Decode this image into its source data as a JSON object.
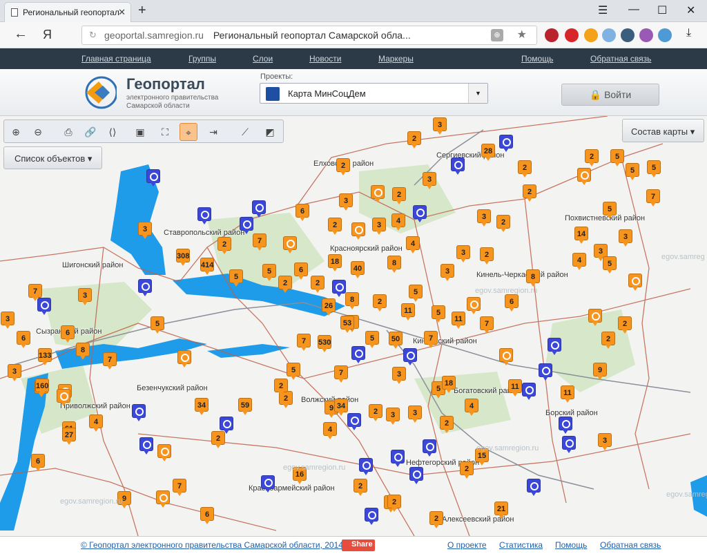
{
  "browser": {
    "tab_title": "Региональный геопортал",
    "url_domain": "geoportal.samregion.ru",
    "url_title": "Региональный геопортал Самарской обла..."
  },
  "nav": {
    "items": [
      "Главная страница",
      "Группы",
      "Слои",
      "Новости",
      "Маркеры",
      "Помощь",
      "Обратная связь"
    ]
  },
  "header": {
    "brand": "Геопортал",
    "brand_sub": "электронного правительства Самарской области",
    "projects_label": "Проекты:",
    "project_value": "Карта МинСоцДем",
    "login_label": "Войти"
  },
  "map_ui": {
    "objects_list": "Список объектов",
    "layers": "Состав карты"
  },
  "map_labels": [
    "Ставропольский район",
    "Шигонский район",
    "Сызранский район",
    "Безенчукский район",
    "Приволжский район",
    "Красноармейский район",
    "Волжский район",
    "Кинель-Черкасский район",
    "Богатовский район",
    "Борский район",
    "Похвистневский район",
    "Нефтегорский район",
    "Алексеевский район",
    "Елховский район",
    "Сергиевский район",
    "Красноярский район",
    "Кинельский район"
  ],
  "colors": {
    "cluster": "#f7941d",
    "poi": "#3b47d8",
    "water": "#1e9be9",
    "border": "#c0604a",
    "nav_bg": "#2c3a48"
  },
  "footer": {
    "copyright": "© Геопортал электронного правительства Самарской области, 2014",
    "share": "Share",
    "links": [
      "О проекте",
      "Статистика",
      "Помощь",
      "Обратная связь"
    ]
  },
  "chart_data": {
    "type": "scatter",
    "title": "",
    "clusters": [
      "3",
      "2",
      "28",
      "2",
      "3",
      "2",
      "2",
      "2",
      "5",
      "5",
      "5",
      "3",
      "7",
      "2",
      "3",
      "6",
      "5",
      "3",
      "2",
      "2",
      "3",
      "3",
      "4",
      "4",
      "2",
      "5",
      "14",
      "3",
      "2",
      "3",
      "7",
      "308",
      "414",
      "18",
      "40",
      "8",
      "4",
      "5",
      "2",
      "5",
      "6",
      "2",
      "3",
      "7",
      "8",
      "6",
      "2",
      "3",
      "34",
      "61",
      "8",
      "4",
      "6",
      "9",
      "26",
      "8",
      "11",
      "5",
      "5",
      "11",
      "2",
      "5",
      "2",
      "3",
      "6",
      "5",
      "53",
      "5",
      "7",
      "11",
      "7",
      "3",
      "133",
      "8",
      "7",
      "50",
      "2",
      "530",
      "9",
      "7",
      "3",
      "11",
      "18",
      "7",
      "2",
      "2",
      "9",
      "160",
      "5",
      "34",
      "59",
      "6",
      "2",
      "4",
      "3",
      "27",
      "4",
      "2",
      "5",
      "3",
      "15",
      "2",
      "16",
      "2",
      "7",
      "2",
      "9",
      "6",
      "2",
      "21",
      "3"
    ],
    "poi_count": 28
  }
}
